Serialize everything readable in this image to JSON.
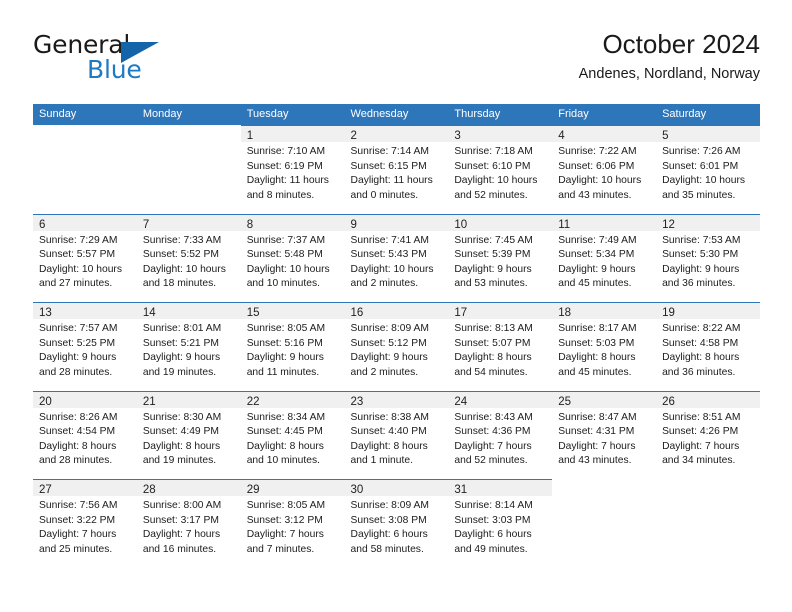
{
  "brand": {
    "name_top": "General",
    "name_bottom": "Blue",
    "accent_color": "#1f7ac4",
    "triangle_color": "#1464aa"
  },
  "header": {
    "title": "October 2024",
    "subtitle": "Andenes, Nordland, Norway"
  },
  "calendar": {
    "header_bg": "#2e76ba",
    "daynum_bg": "#f0f0f0",
    "weekdays": [
      "Sunday",
      "Monday",
      "Tuesday",
      "Wednesday",
      "Thursday",
      "Friday",
      "Saturday"
    ],
    "weeks": [
      [
        {
          "day": "",
          "lines": [
            "",
            "",
            "",
            ""
          ]
        },
        {
          "day": "",
          "lines": [
            "",
            "",
            "",
            ""
          ]
        },
        {
          "day": "1",
          "lines": [
            "Sunrise: 7:10 AM",
            "Sunset: 6:19 PM",
            "Daylight: 11 hours",
            "and 8 minutes."
          ]
        },
        {
          "day": "2",
          "lines": [
            "Sunrise: 7:14 AM",
            "Sunset: 6:15 PM",
            "Daylight: 11 hours",
            "and 0 minutes."
          ]
        },
        {
          "day": "3",
          "lines": [
            "Sunrise: 7:18 AM",
            "Sunset: 6:10 PM",
            "Daylight: 10 hours",
            "and 52 minutes."
          ]
        },
        {
          "day": "4",
          "lines": [
            "Sunrise: 7:22 AM",
            "Sunset: 6:06 PM",
            "Daylight: 10 hours",
            "and 43 minutes."
          ]
        },
        {
          "day": "5",
          "lines": [
            "Sunrise: 7:26 AM",
            "Sunset: 6:01 PM",
            "Daylight: 10 hours",
            "and 35 minutes."
          ]
        }
      ],
      [
        {
          "day": "6",
          "lines": [
            "Sunrise: 7:29 AM",
            "Sunset: 5:57 PM",
            "Daylight: 10 hours",
            "and 27 minutes."
          ]
        },
        {
          "day": "7",
          "lines": [
            "Sunrise: 7:33 AM",
            "Sunset: 5:52 PM",
            "Daylight: 10 hours",
            "and 18 minutes."
          ]
        },
        {
          "day": "8",
          "lines": [
            "Sunrise: 7:37 AM",
            "Sunset: 5:48 PM",
            "Daylight: 10 hours",
            "and 10 minutes."
          ]
        },
        {
          "day": "9",
          "lines": [
            "Sunrise: 7:41 AM",
            "Sunset: 5:43 PM",
            "Daylight: 10 hours",
            "and 2 minutes."
          ]
        },
        {
          "day": "10",
          "lines": [
            "Sunrise: 7:45 AM",
            "Sunset: 5:39 PM",
            "Daylight: 9 hours",
            "and 53 minutes."
          ]
        },
        {
          "day": "11",
          "lines": [
            "Sunrise: 7:49 AM",
            "Sunset: 5:34 PM",
            "Daylight: 9 hours",
            "and 45 minutes."
          ]
        },
        {
          "day": "12",
          "lines": [
            "Sunrise: 7:53 AM",
            "Sunset: 5:30 PM",
            "Daylight: 9 hours",
            "and 36 minutes."
          ]
        }
      ],
      [
        {
          "day": "13",
          "lines": [
            "Sunrise: 7:57 AM",
            "Sunset: 5:25 PM",
            "Daylight: 9 hours",
            "and 28 minutes."
          ]
        },
        {
          "day": "14",
          "lines": [
            "Sunrise: 8:01 AM",
            "Sunset: 5:21 PM",
            "Daylight: 9 hours",
            "and 19 minutes."
          ]
        },
        {
          "day": "15",
          "lines": [
            "Sunrise: 8:05 AM",
            "Sunset: 5:16 PM",
            "Daylight: 9 hours",
            "and 11 minutes."
          ]
        },
        {
          "day": "16",
          "lines": [
            "Sunrise: 8:09 AM",
            "Sunset: 5:12 PM",
            "Daylight: 9 hours",
            "and 2 minutes."
          ]
        },
        {
          "day": "17",
          "lines": [
            "Sunrise: 8:13 AM",
            "Sunset: 5:07 PM",
            "Daylight: 8 hours",
            "and 54 minutes."
          ]
        },
        {
          "day": "18",
          "lines": [
            "Sunrise: 8:17 AM",
            "Sunset: 5:03 PM",
            "Daylight: 8 hours",
            "and 45 minutes."
          ]
        },
        {
          "day": "19",
          "lines": [
            "Sunrise: 8:22 AM",
            "Sunset: 4:58 PM",
            "Daylight: 8 hours",
            "and 36 minutes."
          ]
        }
      ],
      [
        {
          "day": "20",
          "lines": [
            "Sunrise: 8:26 AM",
            "Sunset: 4:54 PM",
            "Daylight: 8 hours",
            "and 28 minutes."
          ]
        },
        {
          "day": "21",
          "lines": [
            "Sunrise: 8:30 AM",
            "Sunset: 4:49 PM",
            "Daylight: 8 hours",
            "and 19 minutes."
          ]
        },
        {
          "day": "22",
          "lines": [
            "Sunrise: 8:34 AM",
            "Sunset: 4:45 PM",
            "Daylight: 8 hours",
            "and 10 minutes."
          ]
        },
        {
          "day": "23",
          "lines": [
            "Sunrise: 8:38 AM",
            "Sunset: 4:40 PM",
            "Daylight: 8 hours",
            "and 1 minute."
          ]
        },
        {
          "day": "24",
          "lines": [
            "Sunrise: 8:43 AM",
            "Sunset: 4:36 PM",
            "Daylight: 7 hours",
            "and 52 minutes."
          ]
        },
        {
          "day": "25",
          "lines": [
            "Sunrise: 8:47 AM",
            "Sunset: 4:31 PM",
            "Daylight: 7 hours",
            "and 43 minutes."
          ]
        },
        {
          "day": "26",
          "lines": [
            "Sunrise: 8:51 AM",
            "Sunset: 4:26 PM",
            "Daylight: 7 hours",
            "and 34 minutes."
          ]
        }
      ],
      [
        {
          "day": "27",
          "lines": [
            "Sunrise: 7:56 AM",
            "Sunset: 3:22 PM",
            "Daylight: 7 hours",
            "and 25 minutes."
          ]
        },
        {
          "day": "28",
          "lines": [
            "Sunrise: 8:00 AM",
            "Sunset: 3:17 PM",
            "Daylight: 7 hours",
            "and 16 minutes."
          ]
        },
        {
          "day": "29",
          "lines": [
            "Sunrise: 8:05 AM",
            "Sunset: 3:12 PM",
            "Daylight: 7 hours",
            "and 7 minutes."
          ]
        },
        {
          "day": "30",
          "lines": [
            "Sunrise: 8:09 AM",
            "Sunset: 3:08 PM",
            "Daylight: 6 hours",
            "and 58 minutes."
          ]
        },
        {
          "day": "31",
          "lines": [
            "Sunrise: 8:14 AM",
            "Sunset: 3:03 PM",
            "Daylight: 6 hours",
            "and 49 minutes."
          ]
        },
        {
          "day": "",
          "lines": [
            "",
            "",
            "",
            ""
          ]
        },
        {
          "day": "",
          "lines": [
            "",
            "",
            "",
            ""
          ]
        }
      ]
    ]
  }
}
